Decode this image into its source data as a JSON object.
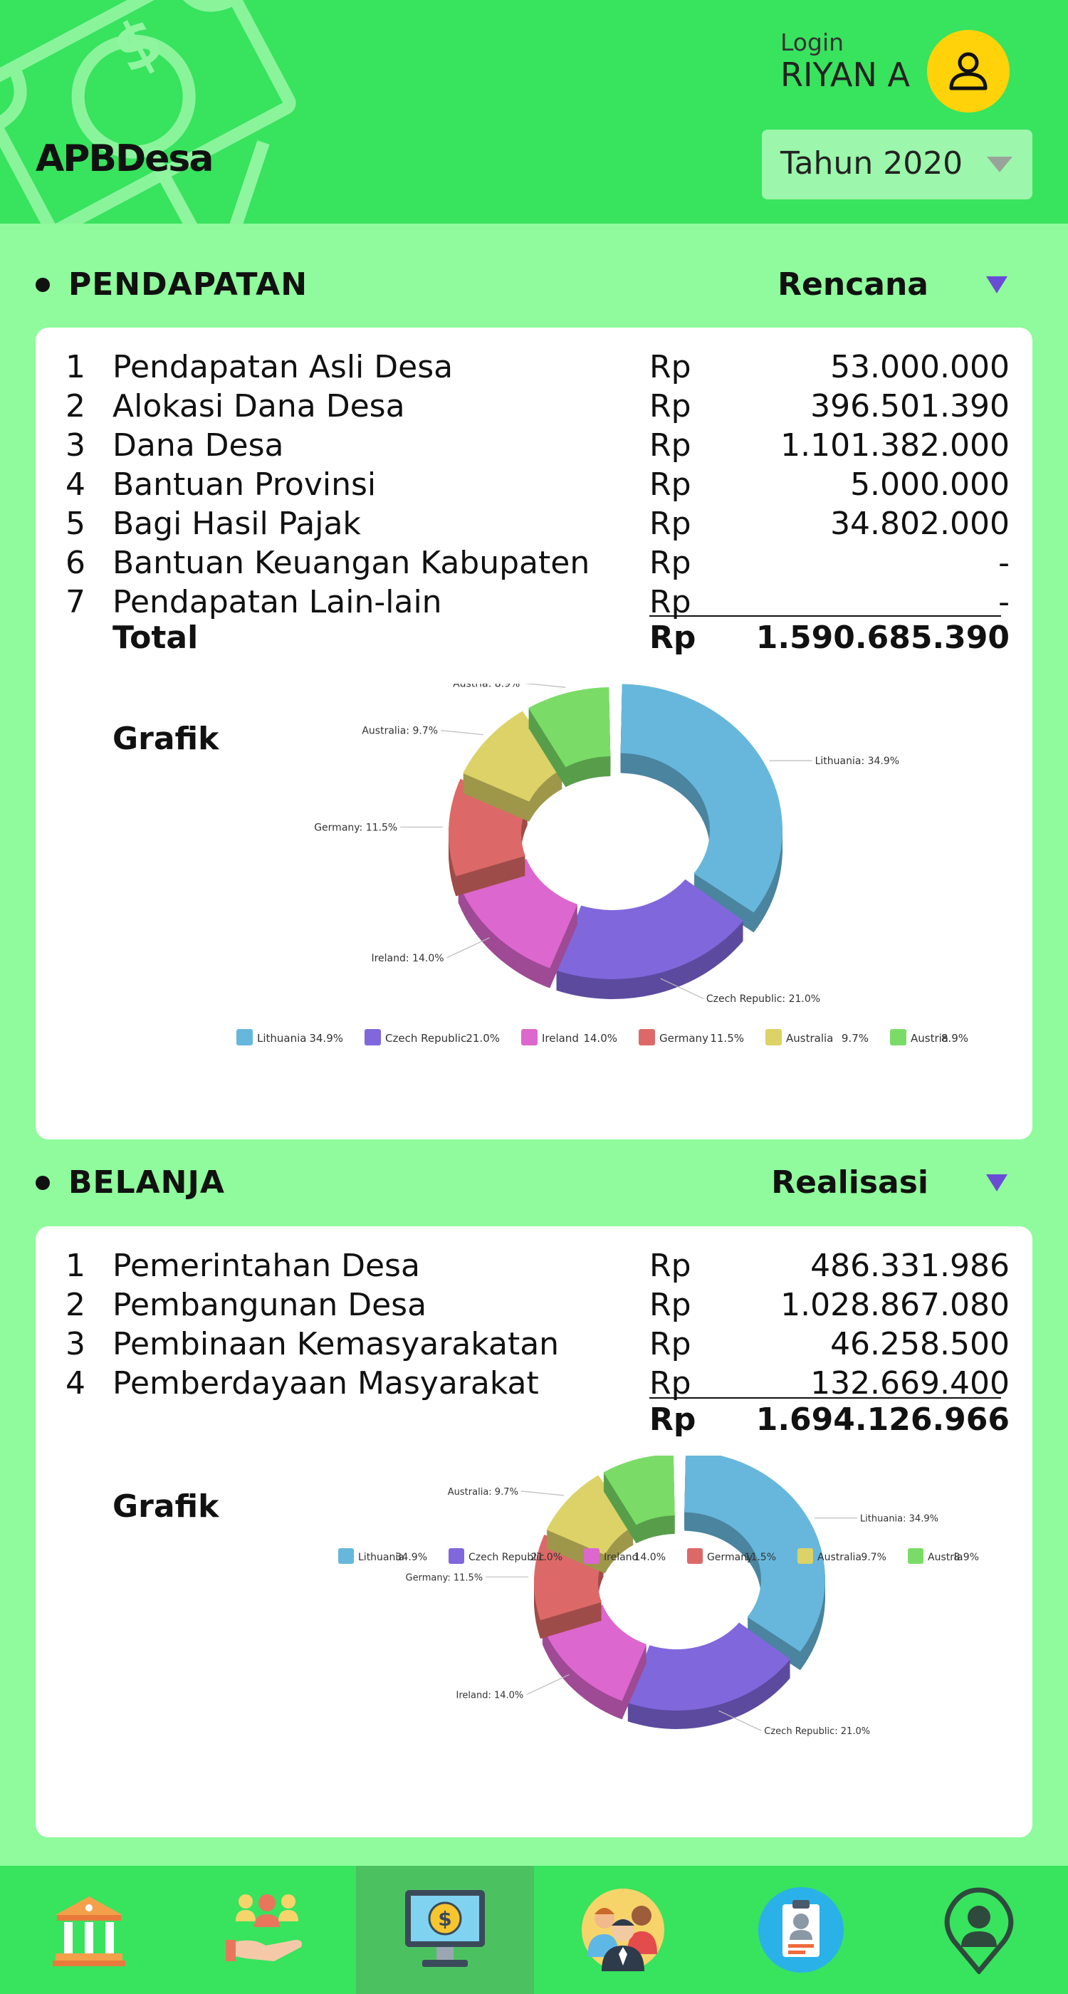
{
  "header": {
    "app_title": "APBDesa",
    "login_label": "Login",
    "user_name": "RIYAN A",
    "year_selected": "Tahun 2020"
  },
  "pendapatan": {
    "title": "PENDAPATAN",
    "mode": "Rencana",
    "currency": "Rp",
    "rows": [
      {
        "no": "1",
        "name": "Pendapatan Asli Desa",
        "amount": "53.000.000"
      },
      {
        "no": "2",
        "name": "Alokasi Dana Desa",
        "amount": "396.501.390"
      },
      {
        "no": "3",
        "name": "Dana Desa",
        "amount": "1.101.382.000"
      },
      {
        "no": "4",
        "name": "Bantuan Provinsi",
        "amount": "5.000.000"
      },
      {
        "no": "5",
        "name": "Bagi Hasil Pajak",
        "amount": "34.802.000"
      },
      {
        "no": "6",
        "name": "Bantuan Keuangan Kabupaten",
        "amount": "-"
      },
      {
        "no": "7",
        "name": "Pendapatan Lain-lain",
        "amount": "-"
      }
    ],
    "total_label": "Total",
    "total_amount": "1.590.685.390",
    "grafik_label": "Grafik"
  },
  "belanja": {
    "title": "BELANJA",
    "mode": "Realisasi",
    "currency": "Rp",
    "rows": [
      {
        "no": "1",
        "name": "Pemerintahan Desa",
        "amount": "486.331.986"
      },
      {
        "no": "2",
        "name": "Pembangunan Desa",
        "amount": "1.028.867.080"
      },
      {
        "no": "3",
        "name": "Pembinaan Kemasyarakatan",
        "amount": "46.258.500"
      },
      {
        "no": "4",
        "name": "Pemberdayaan Masyarakat",
        "amount": "132.669.400"
      }
    ],
    "total_amount": "1.694.126.966",
    "grafik_label": "Grafik"
  },
  "chart_data": [
    {
      "type": "pie",
      "categories": [
        "Lithuania",
        "Czech Republic",
        "Ireland",
        "Germany",
        "Australia",
        "Austria"
      ],
      "values": [
        34.9,
        21.0,
        14.0,
        11.5,
        9.7,
        8.9
      ],
      "colors": [
        "#67b7dc",
        "#8067dc",
        "#dc67ce",
        "#dc6967",
        "#dcd267",
        "#7adc67"
      ],
      "legend": "bottom"
    },
    {
      "type": "pie",
      "categories": [
        "Lithuania",
        "Czech Republic",
        "Ireland",
        "Germany",
        "Australia",
        "Austria"
      ],
      "values": [
        34.9,
        21.0,
        14.0,
        11.5,
        9.7,
        8.9
      ],
      "colors": [
        "#67b7dc",
        "#8067dc",
        "#dc67ce",
        "#dc6967",
        "#dcd267",
        "#7adc67"
      ],
      "legend": "bottom"
    }
  ],
  "nav": {
    "items": [
      {
        "icon": "government-building-icon"
      },
      {
        "icon": "community-hands-icon"
      },
      {
        "icon": "budget-monitor-icon"
      },
      {
        "icon": "people-group-icon"
      },
      {
        "icon": "profile-badge-icon"
      },
      {
        "icon": "location-person-icon"
      }
    ]
  }
}
